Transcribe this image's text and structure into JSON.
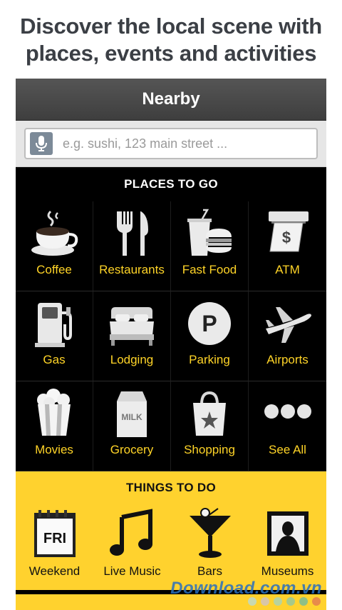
{
  "promo": {
    "line1": "Discover the local scene with",
    "line2": "places, events and activities"
  },
  "appbar": {
    "title": "Nearby"
  },
  "search": {
    "placeholder": "e.g. sushi, 123 main street ...",
    "mic_icon": "microphone-icon"
  },
  "places": {
    "heading": "PLACES TO GO",
    "items": [
      {
        "label": "Coffee",
        "icon": "coffee-cup-icon"
      },
      {
        "label": "Restaurants",
        "icon": "fork-knife-icon"
      },
      {
        "label": "Fast Food",
        "icon": "burger-drink-icon"
      },
      {
        "label": "ATM",
        "icon": "atm-cash-icon"
      },
      {
        "label": "Gas",
        "icon": "gas-pump-icon"
      },
      {
        "label": "Lodging",
        "icon": "bed-icon"
      },
      {
        "label": "Parking",
        "icon": "parking-icon"
      },
      {
        "label": "Airports",
        "icon": "airplane-icon"
      },
      {
        "label": "Movies",
        "icon": "popcorn-icon"
      },
      {
        "label": "Grocery",
        "icon": "milk-carton-icon"
      },
      {
        "label": "Shopping",
        "icon": "shopping-bag-icon"
      },
      {
        "label": "See All",
        "icon": "more-dots-icon"
      }
    ]
  },
  "things": {
    "heading": "THINGS TO DO",
    "items": [
      {
        "label": "Weekend",
        "icon": "calendar-fri-icon",
        "calendar_text": "FRI"
      },
      {
        "label": "Live Music",
        "icon": "music-note-icon"
      },
      {
        "label": "Bars",
        "icon": "cocktail-icon"
      },
      {
        "label": "Museums",
        "icon": "museum-painting-icon"
      }
    ]
  },
  "atm_glyph": "$",
  "grocery_glyph": "MILK",
  "parking_glyph": "P",
  "colors": {
    "accent_yellow": "#ffd22e",
    "label_yellow": "#ffd427",
    "appbar": "#4a4a4a"
  },
  "watermark": {
    "text": "Download.com.vn"
  }
}
